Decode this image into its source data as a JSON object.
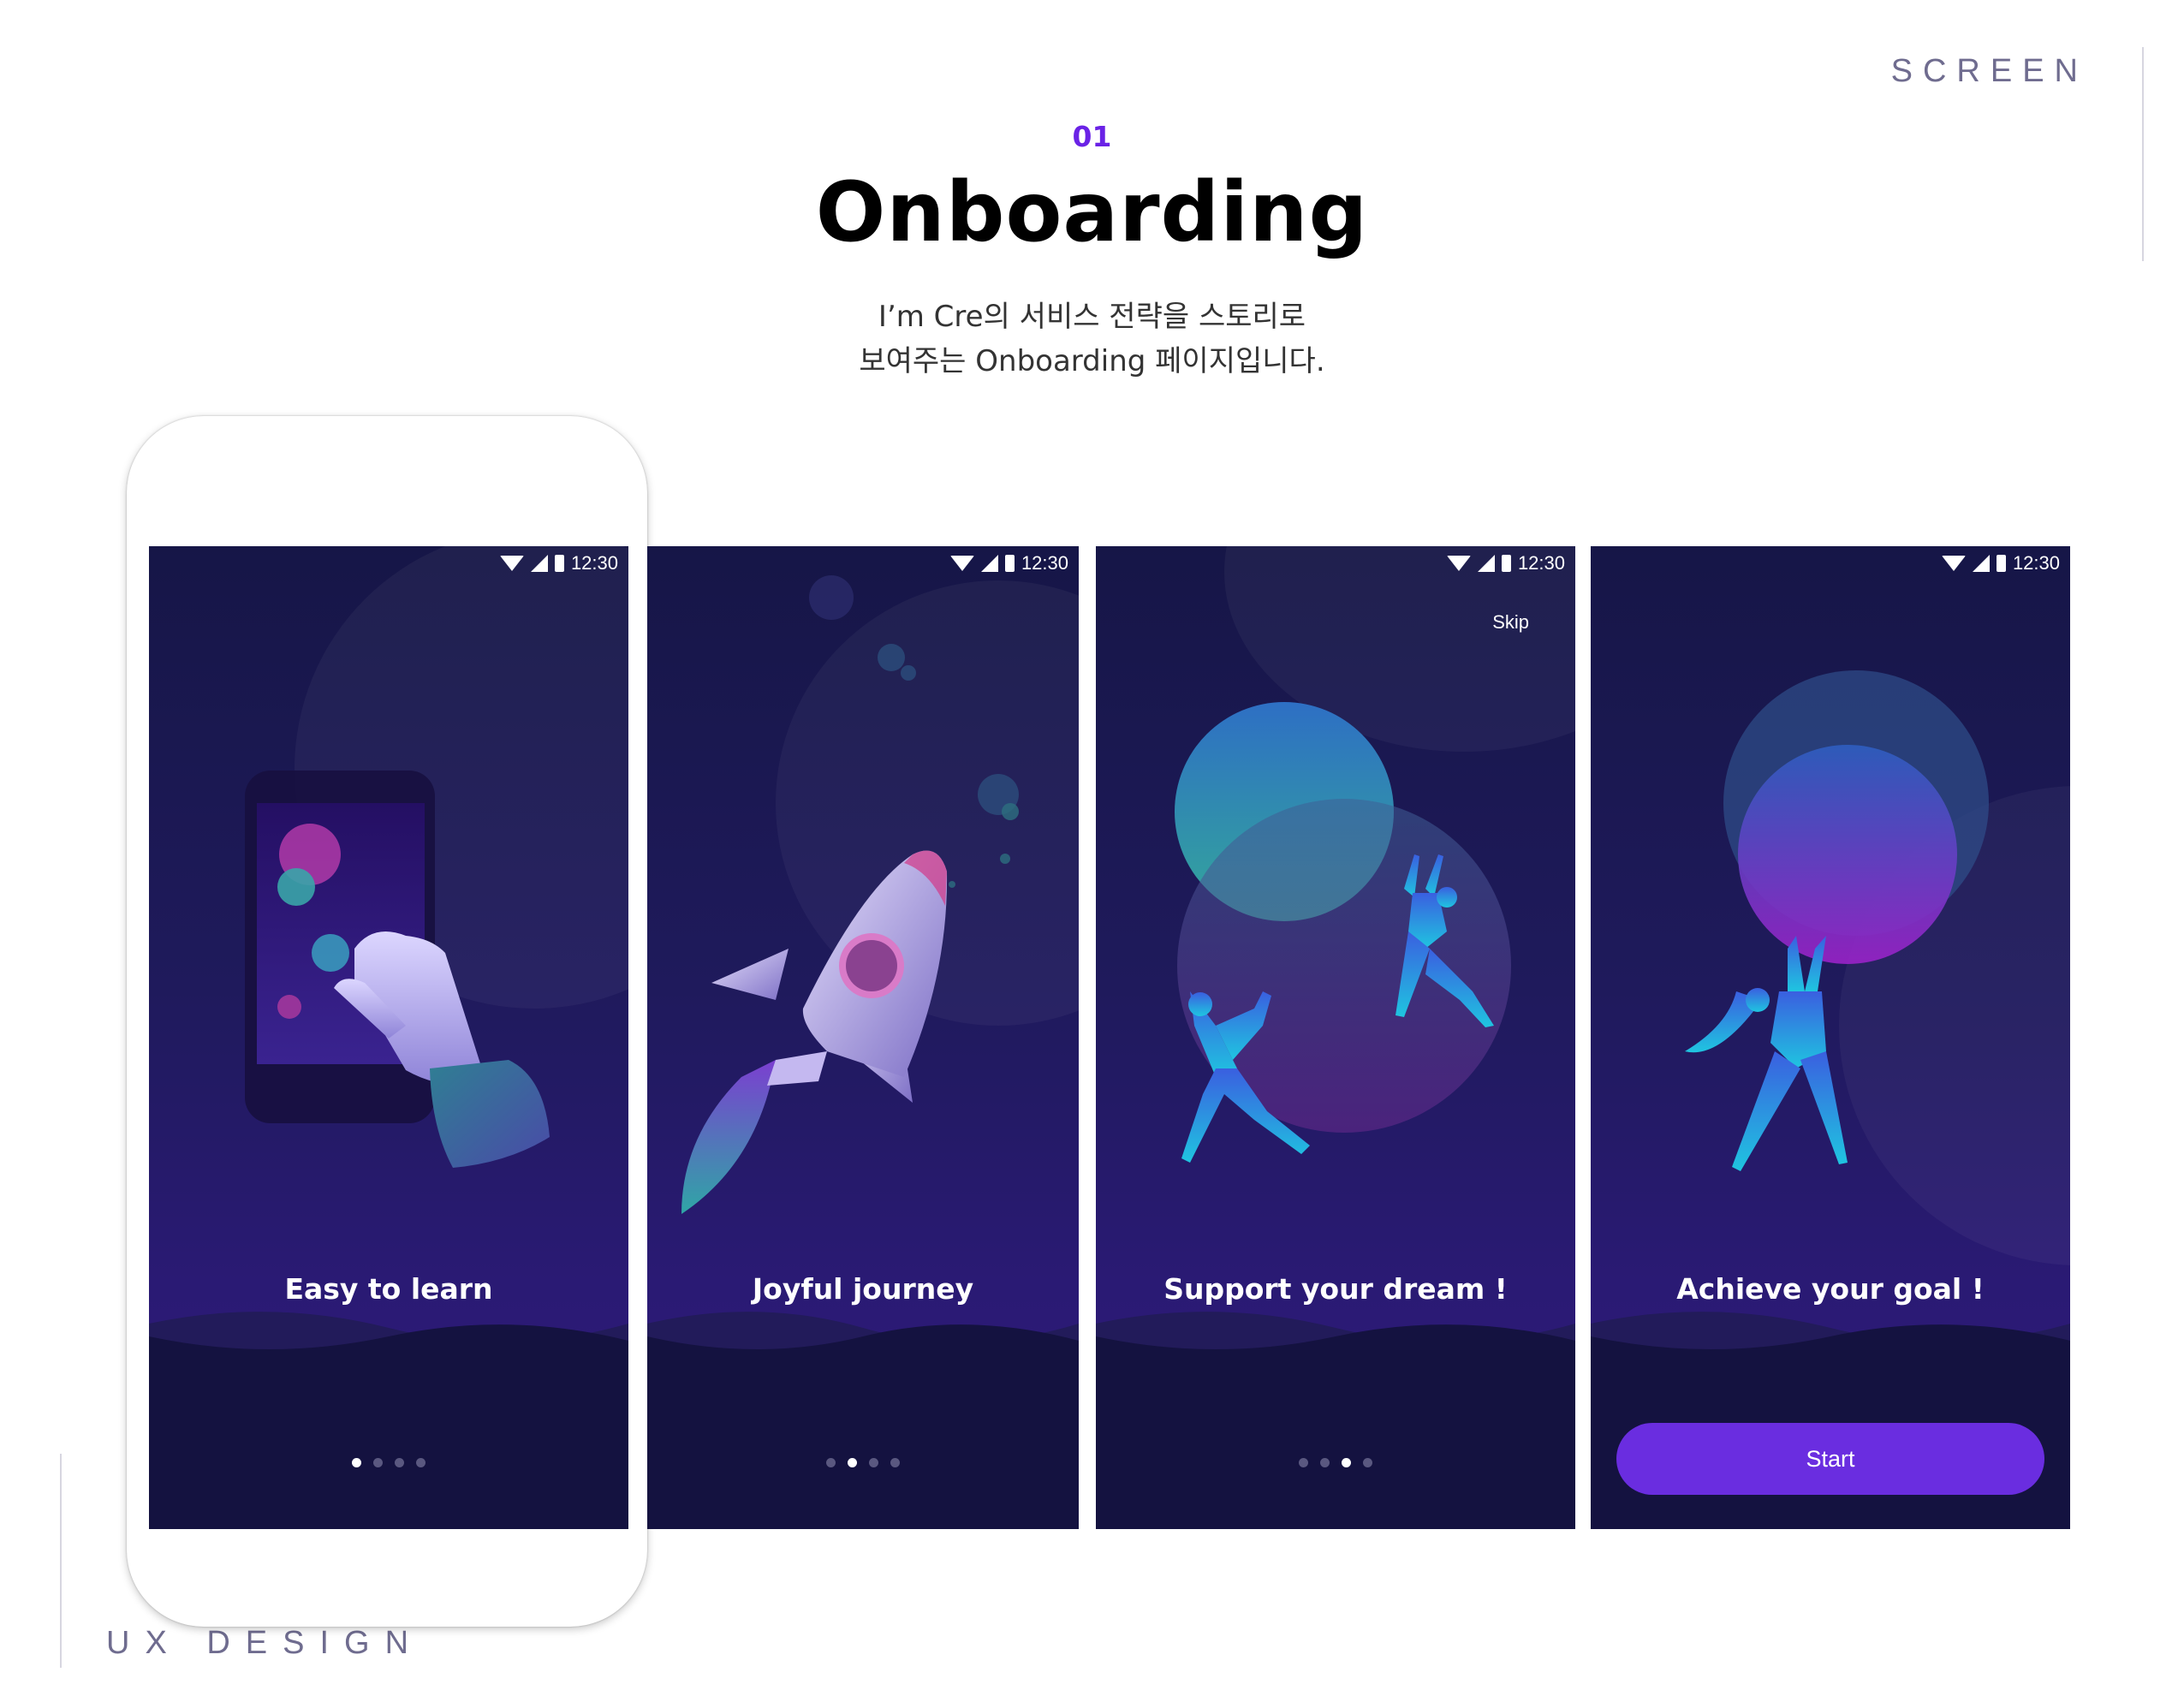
{
  "header": {
    "screen_label": "SCREEN",
    "section_number": "01",
    "title": "Onboarding",
    "description_line1": "I’m Cre의 서비스 전략을 스토리로",
    "description_line2": "보여주는 Onboarding 페이지입니다."
  },
  "footer": {
    "ux_design_label": "UX DESIGN"
  },
  "screens": [
    {
      "time": "12:30",
      "caption": "Easy to learn",
      "active_dot": 0,
      "illustration": "hand-tapping-phone"
    },
    {
      "time": "12:30",
      "caption": "Joyful journey",
      "active_dot": 1,
      "illustration": "rocket"
    },
    {
      "time": "12:30",
      "caption": "Support your dream !",
      "active_dot": 2,
      "skip_label": "Skip",
      "illustration": "people-floating"
    },
    {
      "time": "12:30",
      "caption": "Achieve your goal !",
      "button_label": "Start",
      "illustration": "woman-holding-circle"
    }
  ],
  "colors": {
    "accent": "#6a22e6",
    "button": "#6a2de0",
    "screen_bg_top": "#161647",
    "screen_bg_bottom": "#141240"
  }
}
